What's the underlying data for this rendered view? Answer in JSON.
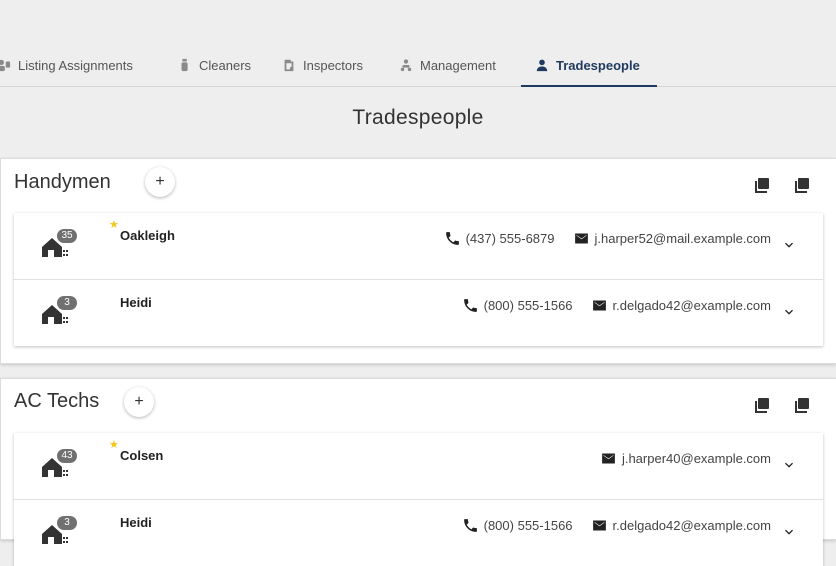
{
  "tabs": [
    {
      "label": "Listing Assignments",
      "icon": "assignment-people-icon"
    },
    {
      "label": "Cleaners",
      "icon": "spray-bottle-icon"
    },
    {
      "label": "Inspectors",
      "icon": "clipboard-search-icon"
    },
    {
      "label": "Management",
      "icon": "management-people-icon"
    },
    {
      "label": "Tradespeople",
      "icon": "person-icon",
      "active": true
    }
  ],
  "page_title": "Tradespeople",
  "groups": [
    {
      "title": "Handymen",
      "add_label": "+",
      "rows": [
        {
          "name": "Oakleigh",
          "listings": "35",
          "starred": true,
          "phone": "(437) 555-6879",
          "email": "j.harper52@mail.example.com"
        },
        {
          "name": "Heidi",
          "listings": "3",
          "starred": false,
          "phone": "(800) 555-1566",
          "email": "r.delgado42@example.com"
        }
      ]
    },
    {
      "title": "AC Techs",
      "add_label": "+",
      "rows": [
        {
          "name": "Colsen",
          "listings": "43",
          "starred": true,
          "phone": "",
          "email": "j.harper40@example.com"
        },
        {
          "name": "Heidi",
          "listings": "3",
          "starred": false,
          "phone": "(800) 555-1566",
          "email": "r.delgado42@example.com"
        }
      ]
    }
  ],
  "star_glyph": "★",
  "colors": {
    "accent": "#1e3a5f",
    "star": "#f5c518",
    "badge": "#707070"
  }
}
